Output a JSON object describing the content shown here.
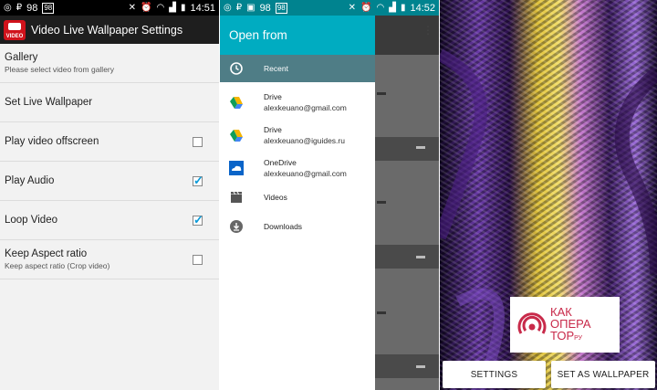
{
  "status_left": {
    "percent": "98",
    "time": "14:51"
  },
  "status_mid": {
    "percent": "98",
    "time": "14:52"
  },
  "settings_screen": {
    "title": "Video Live Wallpaper Settings",
    "logo_text": "VIDEO",
    "rows": [
      {
        "title": "Gallery",
        "subtitle": "Please select video from gallery"
      },
      {
        "title": "Set Live Wallpaper",
        "subtitle": ""
      },
      {
        "title": "Play video offscreen",
        "subtitle": "",
        "checked": false
      },
      {
        "title": "Play Audio",
        "subtitle": "",
        "checked": true
      },
      {
        "title": "Loop Video",
        "subtitle": "",
        "checked": true
      },
      {
        "title": "Keep Aspect ratio",
        "subtitle": "Keep aspect ratio (Crop video)",
        "checked": false
      }
    ]
  },
  "open_from": {
    "title": "Open from",
    "items": [
      {
        "label": "Recent",
        "account": "",
        "icon": "clock-icon",
        "active": true
      },
      {
        "label": "Drive",
        "account": "alexkeuano@gmail.com",
        "icon": "google-drive-icon"
      },
      {
        "label": "Drive",
        "account": "alexkeuano@iguides.ru",
        "icon": "google-drive-icon"
      },
      {
        "label": "OneDrive",
        "account": "alexkeuano@gmail.com",
        "icon": "onedrive-icon"
      },
      {
        "label": "Videos",
        "account": "",
        "icon": "clapperboard-icon"
      },
      {
        "label": "Downloads",
        "account": "",
        "icon": "download-icon"
      }
    ]
  },
  "preview": {
    "watermark": [
      "КАК",
      "ОПЕРА",
      "ТОР",
      "РУ"
    ],
    "settings_button": "SETTINGS",
    "set_wallpaper_button": "SET AS WALLPAPER"
  },
  "colors": {
    "accent_teal": "#00acc1",
    "status_teal": "#00838f",
    "checkbox_blue": "#0a9ad8",
    "logo_red": "#d0121b"
  }
}
